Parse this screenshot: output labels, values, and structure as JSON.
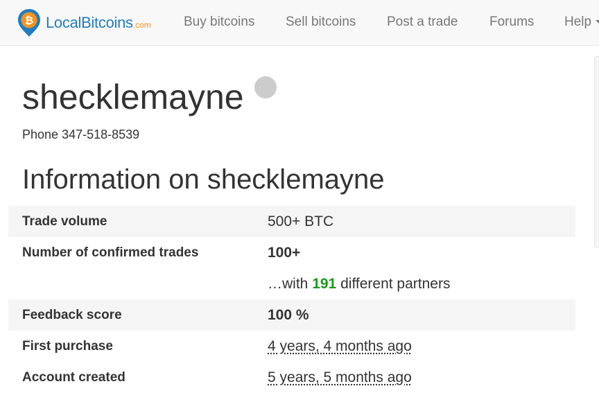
{
  "navbar": {
    "brand": {
      "name": "LocalBitcoins",
      "suffix": ".com"
    },
    "items": [
      {
        "label": "Buy bitcoins"
      },
      {
        "label": "Sell bitcoins"
      },
      {
        "label": "Post a trade"
      },
      {
        "label": "Forums"
      },
      {
        "label": "Help"
      }
    ]
  },
  "profile": {
    "username": "shecklemayne",
    "status_color": "#cccccc",
    "phone_label": "Phone",
    "phone_number": "347-518-8539"
  },
  "info": {
    "heading": "Information on shecklemayne",
    "rows": [
      {
        "label": "Trade volume",
        "value": "500+ BTC"
      },
      {
        "label": "Number of confirmed trades",
        "value": "100+"
      },
      {
        "prefix": "…with",
        "count": "191",
        "suffix": "different partners"
      },
      {
        "label": "Feedback score",
        "value": "100 %"
      },
      {
        "label": "First purchase",
        "value": "4 years, 4 months ago"
      },
      {
        "label": "Account created",
        "value": "5 years, 5 months ago"
      }
    ]
  },
  "colors": {
    "brand_blue": "#1f7dc1",
    "brand_orange": "#f6921e",
    "success_green": "#1a9a1a"
  }
}
